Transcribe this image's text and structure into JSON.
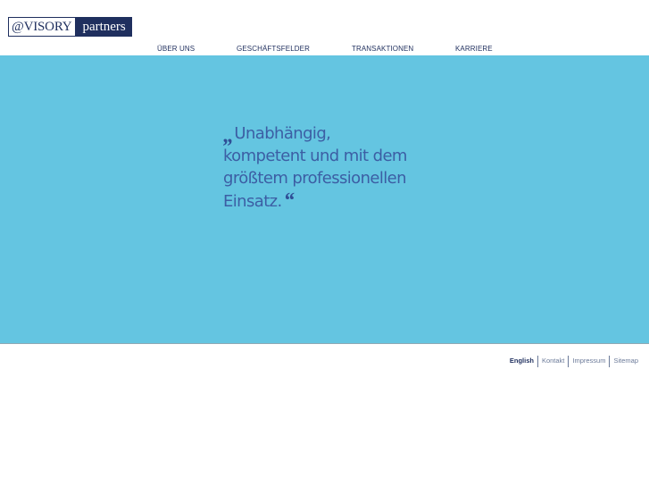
{
  "logo": {
    "left_text": "@VISORY",
    "right_text": "partners"
  },
  "nav": {
    "items": [
      {
        "label": "ÜBER UNS"
      },
      {
        "label": "GESCHÄFTSFELDER"
      },
      {
        "label": "TRANSAKTIONEN"
      },
      {
        "label": "KARRIERE"
      }
    ]
  },
  "hero": {
    "background": "#64c5e1",
    "quote_open": "„",
    "quote_lines": [
      "Unabhängig,",
      "kompetent und mit dem",
      "größtem professionellen",
      "Einsatz."
    ],
    "quote_close": "“"
  },
  "footer": {
    "links": [
      {
        "label": "English"
      },
      {
        "label": "Kontakt"
      },
      {
        "label": "Impressum"
      },
      {
        "label": "Sitemap"
      }
    ]
  }
}
